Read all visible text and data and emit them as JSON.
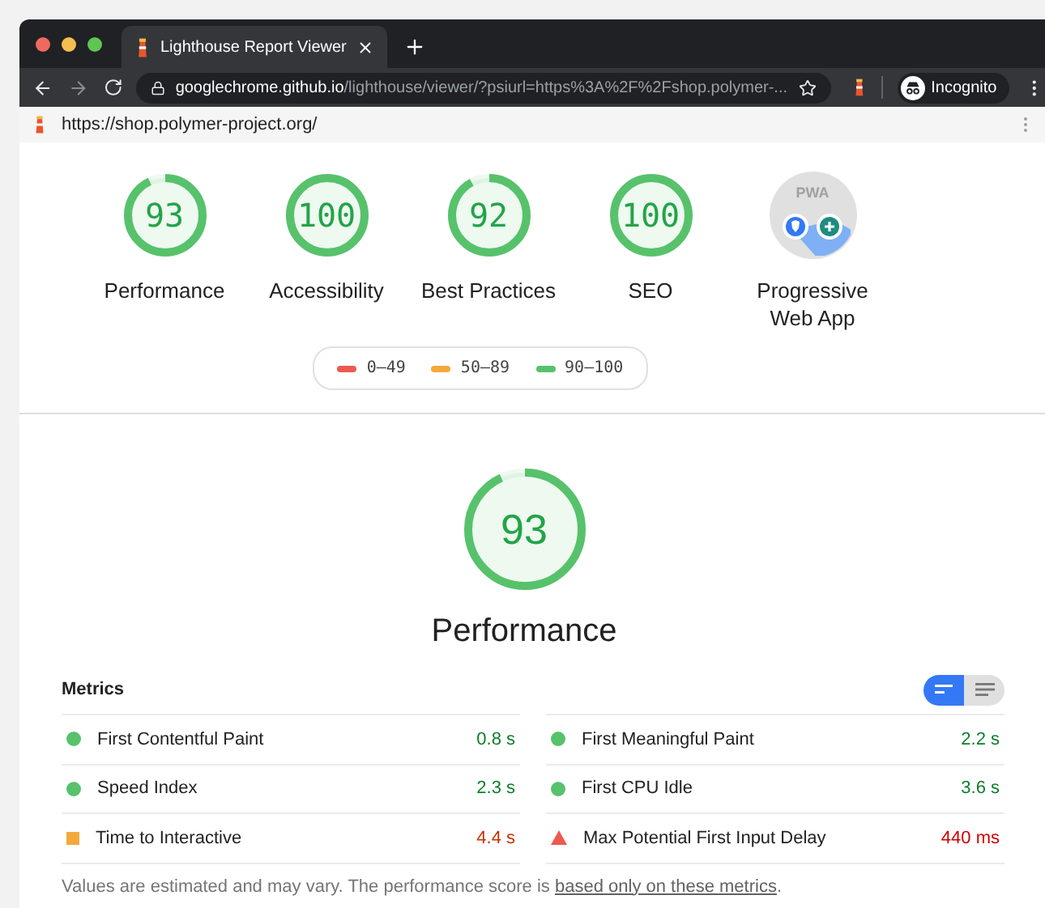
{
  "browser": {
    "tab_title": "Lighthouse Report Viewer",
    "url_host": "googlechrome.github.io",
    "url_path": "/lighthouse/viewer/?psiurl=https%3A%2F%2Fshop.polymer-...",
    "profile": "Incognito"
  },
  "report_url": "https://shop.polymer-project.org/",
  "gauges": [
    {
      "kind": "score",
      "score": "93",
      "level": 0.93,
      "label": "Performance"
    },
    {
      "kind": "score",
      "score": "100",
      "level": 1,
      "label": "Accessibility"
    },
    {
      "kind": "score",
      "score": "92",
      "level": 0.92,
      "label": "Best Practices"
    },
    {
      "kind": "score",
      "score": "100",
      "level": 1,
      "label": "SEO"
    },
    {
      "kind": "pwa",
      "badge": "PWA",
      "label": "Progressive Web App"
    }
  ],
  "legend": [
    {
      "label": "0–49",
      "color": "#ec5a4d"
    },
    {
      "label": "50–89",
      "color": "#f4a93b"
    },
    {
      "label": "90–100",
      "color": "#57c26b"
    }
  ],
  "category": {
    "score": "93",
    "level": 0.93,
    "title": "Performance"
  },
  "metrics_title": "Metrics",
  "view_toggle": [
    {
      "kind": "compact",
      "selected": true
    },
    {
      "kind": "expanded",
      "selected": false
    }
  ],
  "metrics": [
    {
      "name": "First Contentful Paint",
      "value": "0.8 s",
      "kind": "pass"
    },
    {
      "name": "First Meaningful Paint",
      "value": "2.2 s",
      "kind": "pass"
    },
    {
      "name": "Speed Index",
      "value": "2.3 s",
      "kind": "pass"
    },
    {
      "name": "First CPU Idle",
      "value": "3.6 s",
      "kind": "pass"
    },
    {
      "name": "Time to Interactive",
      "value": "4.4 s",
      "kind": "average"
    },
    {
      "name": "Max Potential First Input Delay",
      "value": "440 ms",
      "kind": "fail"
    }
  ],
  "footnote": {
    "text": "Values are estimated and may vary. The performance score is ",
    "link": "based only on these metrics",
    "end": "."
  }
}
